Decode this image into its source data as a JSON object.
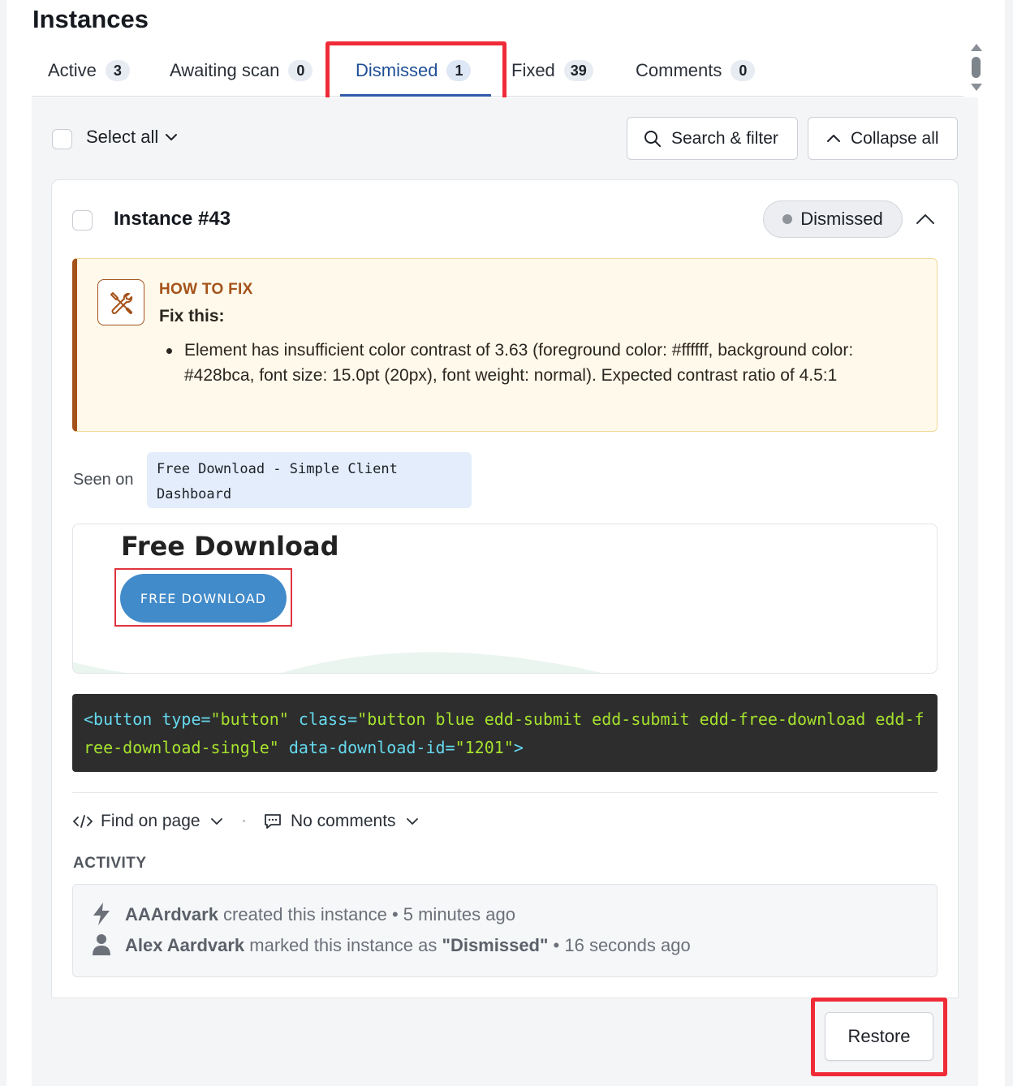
{
  "page_title": "Instances",
  "tabs": [
    {
      "label": "Active",
      "count": "3"
    },
    {
      "label": "Awaiting scan",
      "count": "0"
    },
    {
      "label": "Dismissed",
      "count": "1"
    },
    {
      "label": "Fixed",
      "count": "39"
    },
    {
      "label": "Comments",
      "count": "0"
    }
  ],
  "active_tab": "Dismissed",
  "toolbar": {
    "select_all_label": "Select all",
    "search_filter_label": "Search & filter",
    "collapse_all_label": "Collapse all"
  },
  "instance": {
    "title": "Instance #43",
    "status": "Dismissed",
    "how_to_fix": {
      "heading": "HOW TO FIX",
      "subheading": "Fix this:",
      "items": [
        "Element has insufficient color contrast of 3.63 (foreground color: #ffffff, background color: #428bca, font size: 15.0pt (20px), font weight: normal). Expected contrast ratio of 4.5:1"
      ]
    },
    "seen_on_label": "Seen on",
    "seen_on_page": "Free Download - Simple Client Dashboard",
    "preview": {
      "heading": "Free Download",
      "button_label": "FREE DOWNLOAD"
    },
    "code": {
      "tag_open": "<button",
      "attr1": " type=",
      "val1": "\"button\"",
      "attr2": " class=",
      "val2": "\"button blue edd-submit edd-submit edd-free-download edd-free-download-single\"",
      "attr3": " data-download-id=",
      "val3": "\"1201\"",
      "tag_close": ">"
    },
    "find_on_page_label": "Find on page",
    "comments_label": "No comments",
    "activity_label": "ACTIVITY",
    "activity": [
      {
        "actor": "AAArdvark",
        "action": " created this instance • 5 minutes ago",
        "icon": "lightning-icon"
      },
      {
        "actor": "Alex Aardvark",
        "action": " marked this instance as ",
        "status": "\"Dismissed\"",
        "time": " • 16 seconds ago",
        "icon": "user-icon"
      }
    ],
    "restore_label": "Restore"
  },
  "colors": {
    "active_tab": "#1f4f96",
    "highlight": "#f02b38",
    "how_to_fix_accent": "#a5521a",
    "preview_button": "#428bca",
    "code_bg": "#2d2d2d"
  }
}
